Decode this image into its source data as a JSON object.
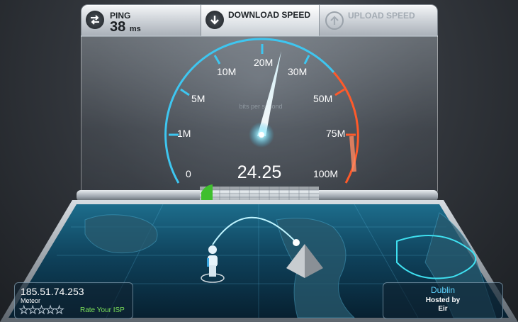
{
  "tabs": {
    "ping": {
      "label": "PING",
      "value": "38",
      "unit": "ms"
    },
    "download": {
      "label": "DOWNLOAD SPEED"
    },
    "upload": {
      "label": "UPLOAD SPEED"
    }
  },
  "gauge": {
    "unit_label": "bits per second",
    "ticks": [
      "0",
      "1M",
      "5M",
      "10M",
      "20M",
      "30M",
      "50M",
      "75M",
      "100M"
    ],
    "reading": "24.25",
    "accent": "#3ec6f0",
    "danger": "#ff5a2a"
  },
  "server": {
    "ip": "185.51.74.253",
    "isp": "Meteor",
    "rate_label": "Rate Your ISP",
    "city": "Dublin",
    "hosted_by_label": "Hosted by",
    "host": "Eir"
  }
}
